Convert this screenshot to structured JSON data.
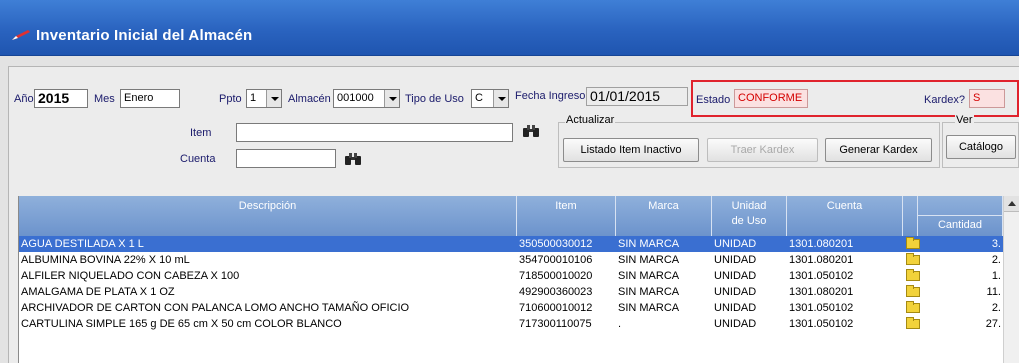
{
  "window": {
    "title": "Inventario Inicial del Almacén"
  },
  "filters": {
    "anio_label": "Año",
    "anio_value": "2015",
    "mes_label": "Mes",
    "mes_value": "Enero",
    "ppto_label": "Ppto",
    "ppto_value": "1",
    "almacen_label": "Almacén",
    "almacen_value": "001000",
    "tipo_uso_label": "Tipo de Uso",
    "tipo_uso_value": "C",
    "fecha_label": "Fecha Ingreso",
    "fecha_value": "01/01/2015",
    "estado_label": "Estado",
    "estado_value": "CONFORME",
    "kardex_label": "Kardex?",
    "kardex_value": "S",
    "item_label": "Item",
    "item_value": "",
    "cuenta_label": "Cuenta",
    "cuenta_value": ""
  },
  "groups": {
    "actualizar_label": "Actualizar",
    "ver_label": "Ver"
  },
  "buttons": {
    "listado": "Listado Item Inactivo",
    "traer": "Traer Kardex",
    "generar": "Generar Kardex",
    "catalogo": "Catálogo"
  },
  "grid": {
    "headers": {
      "descripcion": "Descripción",
      "item": "Item",
      "marca": "Marca",
      "unidad_1": "Unidad",
      "unidad_2": "de Uso",
      "cuenta": "Cuenta",
      "cantidad": "Cantidad"
    },
    "rows": [
      {
        "descripcion": "AGUA DESTILADA X 1 L",
        "item": "350500030012",
        "marca": "SIN MARCA",
        "unidad": "UNIDAD",
        "cuenta": "1301.080201",
        "cantidad": "3."
      },
      {
        "descripcion": "ALBUMINA BOVINA 22% X 10 mL",
        "item": "354700010106",
        "marca": "SIN MARCA",
        "unidad": "UNIDAD",
        "cuenta": "1301.080201",
        "cantidad": "2."
      },
      {
        "descripcion": "ALFILER NIQUELADO CON CABEZA X 100",
        "item": "718500010020",
        "marca": "SIN MARCA",
        "unidad": "UNIDAD",
        "cuenta": "1301.050102",
        "cantidad": "1."
      },
      {
        "descripcion": "AMALGAMA DE PLATA X 1 OZ",
        "item": "492900360023",
        "marca": "SIN MARCA",
        "unidad": "UNIDAD",
        "cuenta": "1301.080201",
        "cantidad": "11."
      },
      {
        "descripcion": "ARCHIVADOR DE CARTON CON PALANCA LOMO ANCHO TAMAÑO OFICIO",
        "item": "710600010012",
        "marca": "SIN MARCA",
        "unidad": "UNIDAD",
        "cuenta": "1301.050102",
        "cantidad": "2."
      },
      {
        "descripcion": "CARTULINA SIMPLE 165 g DE 65 cm X 50 cm COLOR BLANCO",
        "item": "717300110075",
        "marca": ".",
        "unidad": "UNIDAD",
        "cuenta": "1301.050102",
        "cantidad": "27."
      }
    ]
  },
  "colors": {
    "title_bar": "#2a63bf",
    "selection": "#3a6fd1",
    "header": "#7b9fd3",
    "highlight_box": "#e0232d"
  }
}
